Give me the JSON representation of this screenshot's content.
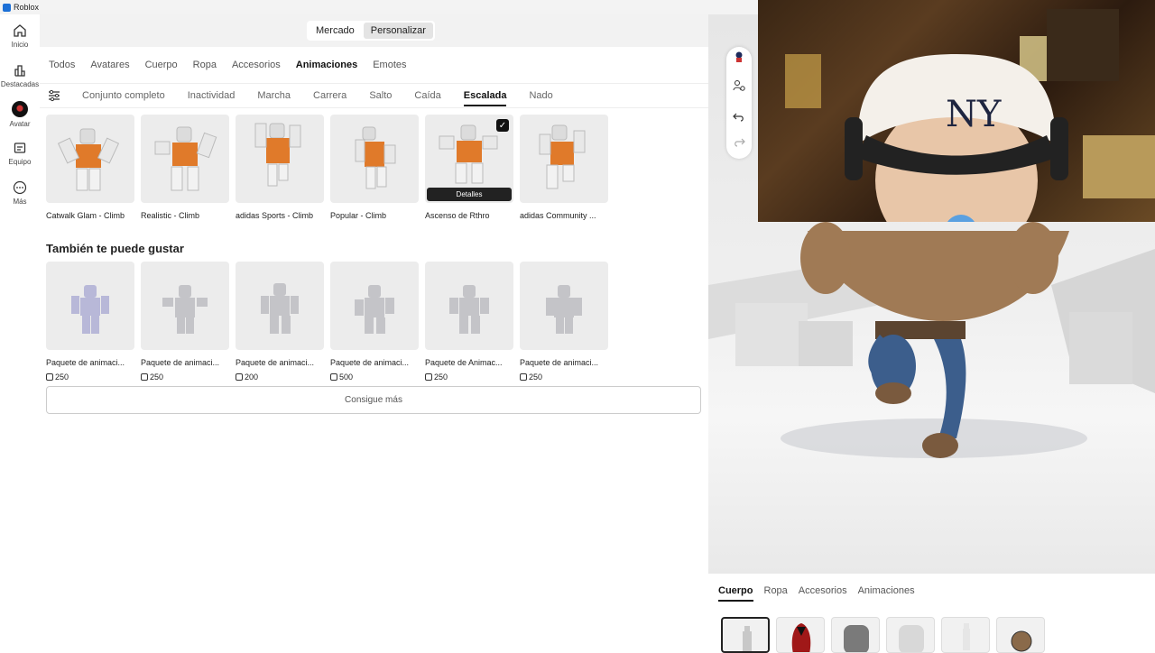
{
  "window": {
    "title": "Roblox"
  },
  "sidenav": [
    {
      "label": "Inicio",
      "icon": "home-icon"
    },
    {
      "label": "Destacadas",
      "icon": "charts-icon"
    },
    {
      "label": "Avatar",
      "icon": "avatar-icon"
    },
    {
      "label": "Equipo",
      "icon": "inventory-icon"
    },
    {
      "label": "Más",
      "icon": "more-icon"
    }
  ],
  "segmented": {
    "market": "Mercado",
    "customize": "Personalizar"
  },
  "tabs": [
    "Todos",
    "Avatares",
    "Cuerpo",
    "Ropa",
    "Accesorios",
    "Animaciones",
    "Emotes"
  ],
  "subtabs": [
    "Conjunto completo",
    "Inactividad",
    "Marcha",
    "Carrera",
    "Salto",
    "Caída",
    "Escalada",
    "Nado"
  ],
  "owned_items": [
    {
      "name": "Catwalk Glam - Climb"
    },
    {
      "name": "Realistic - Climb"
    },
    {
      "name": "adidas Sports - Climb"
    },
    {
      "name": "Popular - Climb"
    },
    {
      "name": "Ascenso de Rthro",
      "badge": "Detalles"
    },
    {
      "name": "adidas Community ..."
    }
  ],
  "recommend_title": "También te puede gustar",
  "recommended": [
    {
      "name": "Paquete de animaci...",
      "price": "250"
    },
    {
      "name": "Paquete de animaci...",
      "price": "250"
    },
    {
      "name": "Paquete de animaci...",
      "price": "200"
    },
    {
      "name": "Paquete de animaci...",
      "price": "500"
    },
    {
      "name": "Paquete de Animac...",
      "price": "250"
    },
    {
      "name": "Paquete de animaci...",
      "price": "250"
    }
  ],
  "more_button": "Consigue más",
  "bottom_tabs": [
    "Cuerpo",
    "Ropa",
    "Accesorios",
    "Animaciones"
  ],
  "colors": {
    "selected": "#111111",
    "tile": "#ececec",
    "skin": "#8a6a4a"
  }
}
